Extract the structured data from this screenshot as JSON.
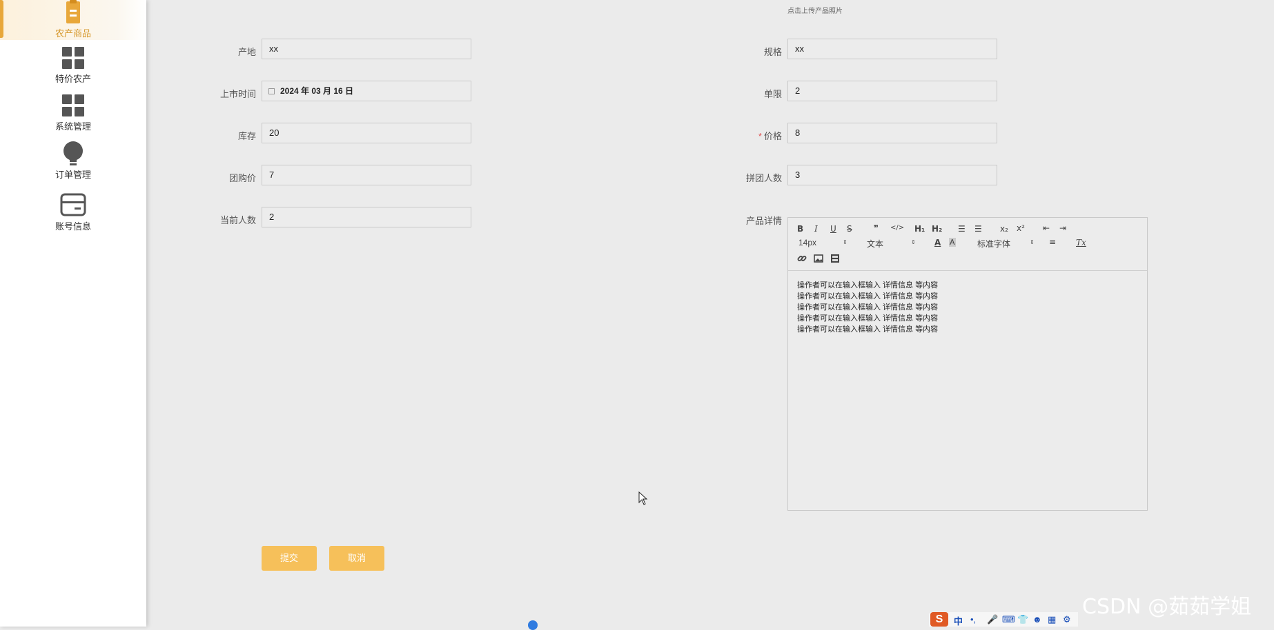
{
  "sidebar": {
    "items": [
      {
        "label": "农产商品",
        "icon": "clipboard-icon",
        "active": true
      },
      {
        "label": "特价农产",
        "icon": "grid-icon"
      },
      {
        "label": "系统管理",
        "icon": "grid-icon"
      },
      {
        "label": "订单管理",
        "icon": "lightbulb-icon"
      },
      {
        "label": "账号信息",
        "icon": "card-icon"
      }
    ]
  },
  "form": {
    "upload_hint": "点击上传产品照片",
    "origin": {
      "label": "产地",
      "value": "xx"
    },
    "spec": {
      "label": "规格",
      "value": "xx"
    },
    "listing_date": {
      "label": "上市时间",
      "value": "2024 年 03 月 16 日"
    },
    "limit": {
      "label": "单限",
      "value": "2"
    },
    "stock": {
      "label": "库存",
      "value": "20"
    },
    "price": {
      "label": "价格",
      "required_mark": "*",
      "value": "8"
    },
    "group_price": {
      "label": "团购价",
      "value": "7"
    },
    "group_size": {
      "label": "拼团人数",
      "value": "3"
    },
    "current_count": {
      "label": "当前人数",
      "value": "2"
    },
    "detail": {
      "label": "产品详情",
      "toolbar": {
        "bold": "B",
        "italic": "I",
        "underline": "U",
        "strike": "S",
        "quote": "❞",
        "code": "</>",
        "h1": "H₁",
        "h2": "H₂",
        "ordered_list": "☰",
        "bullet_list": "☰",
        "subscript": "x₂",
        "superscript": "x²",
        "outdent": "⇤",
        "indent": "⇥",
        "font_size": "14px",
        "block_type": "文本",
        "font_family": "标准字体",
        "color": "A",
        "background": "A",
        "align": "≡",
        "clear": "Tx",
        "link": "🔗",
        "image": "▣",
        "video": "▤"
      },
      "lines": [
        "操作者可以在输入框输入  详情信息  等内容",
        "操作者可以在输入框输入  详情信息  等内容",
        "操作者可以在输入框输入  详情信息  等内容",
        "操作者可以在输入框输入  详情信息  等内容",
        "操作者可以在输入框输入  详情信息  等内容"
      ]
    }
  },
  "buttons": {
    "submit": "提交",
    "cancel": "取消"
  },
  "watermark": "CSDN @茹茹学姐",
  "ime": {
    "logo": "S",
    "lang": "中",
    "punct": "•,",
    "icons": [
      "mic-icon",
      "keyboard-icon",
      "shirt-icon",
      "robot-icon",
      "grid-icon",
      "settings-icon"
    ]
  }
}
